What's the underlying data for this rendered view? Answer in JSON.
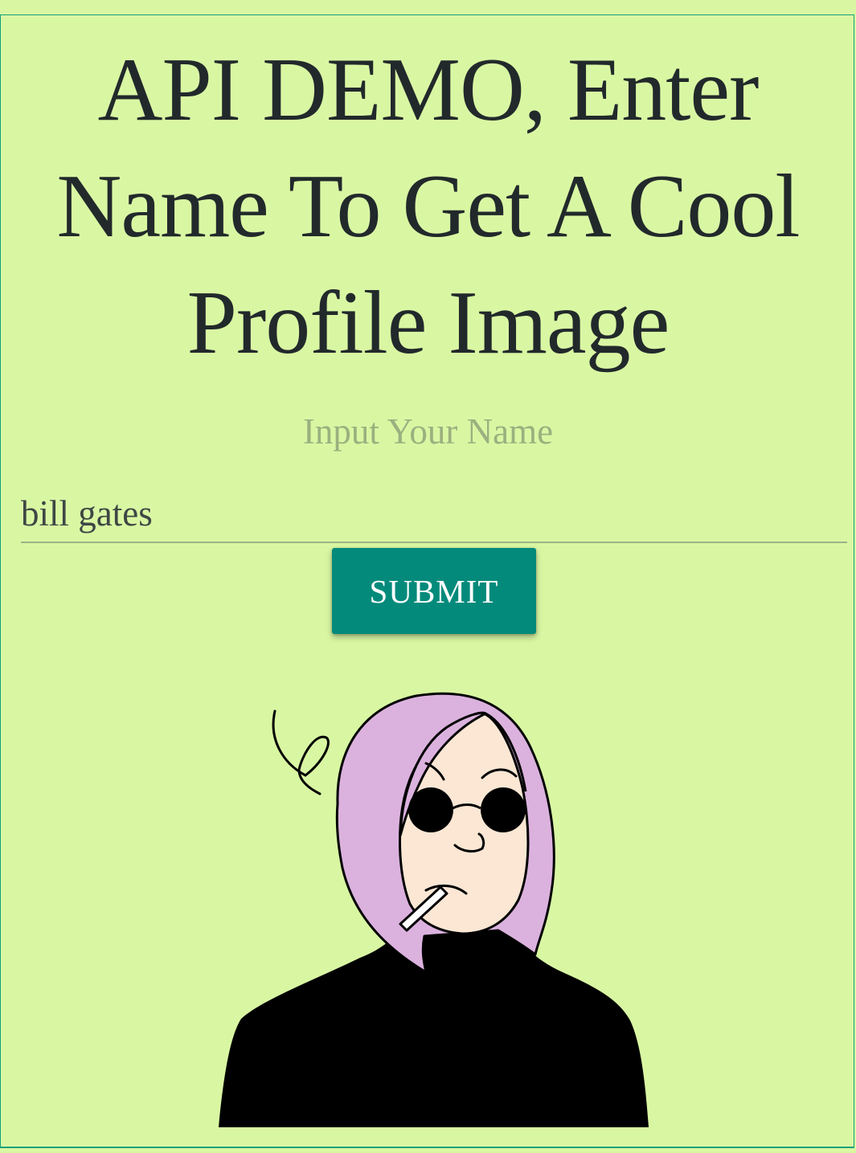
{
  "page": {
    "title": "API DEMO, Enter Name To Get A Cool Profile Image"
  },
  "form": {
    "label": "Input Your Name",
    "input_value": "bill gates",
    "submit_label": "SUBMIT"
  },
  "colors": {
    "background": "#d9f7a3",
    "border": "#14a07a",
    "button": "#038a7b",
    "hair": "#dbb2de",
    "skin": "#fbe7d4"
  },
  "profile_image": {
    "icon": "cartoon-avatar"
  }
}
